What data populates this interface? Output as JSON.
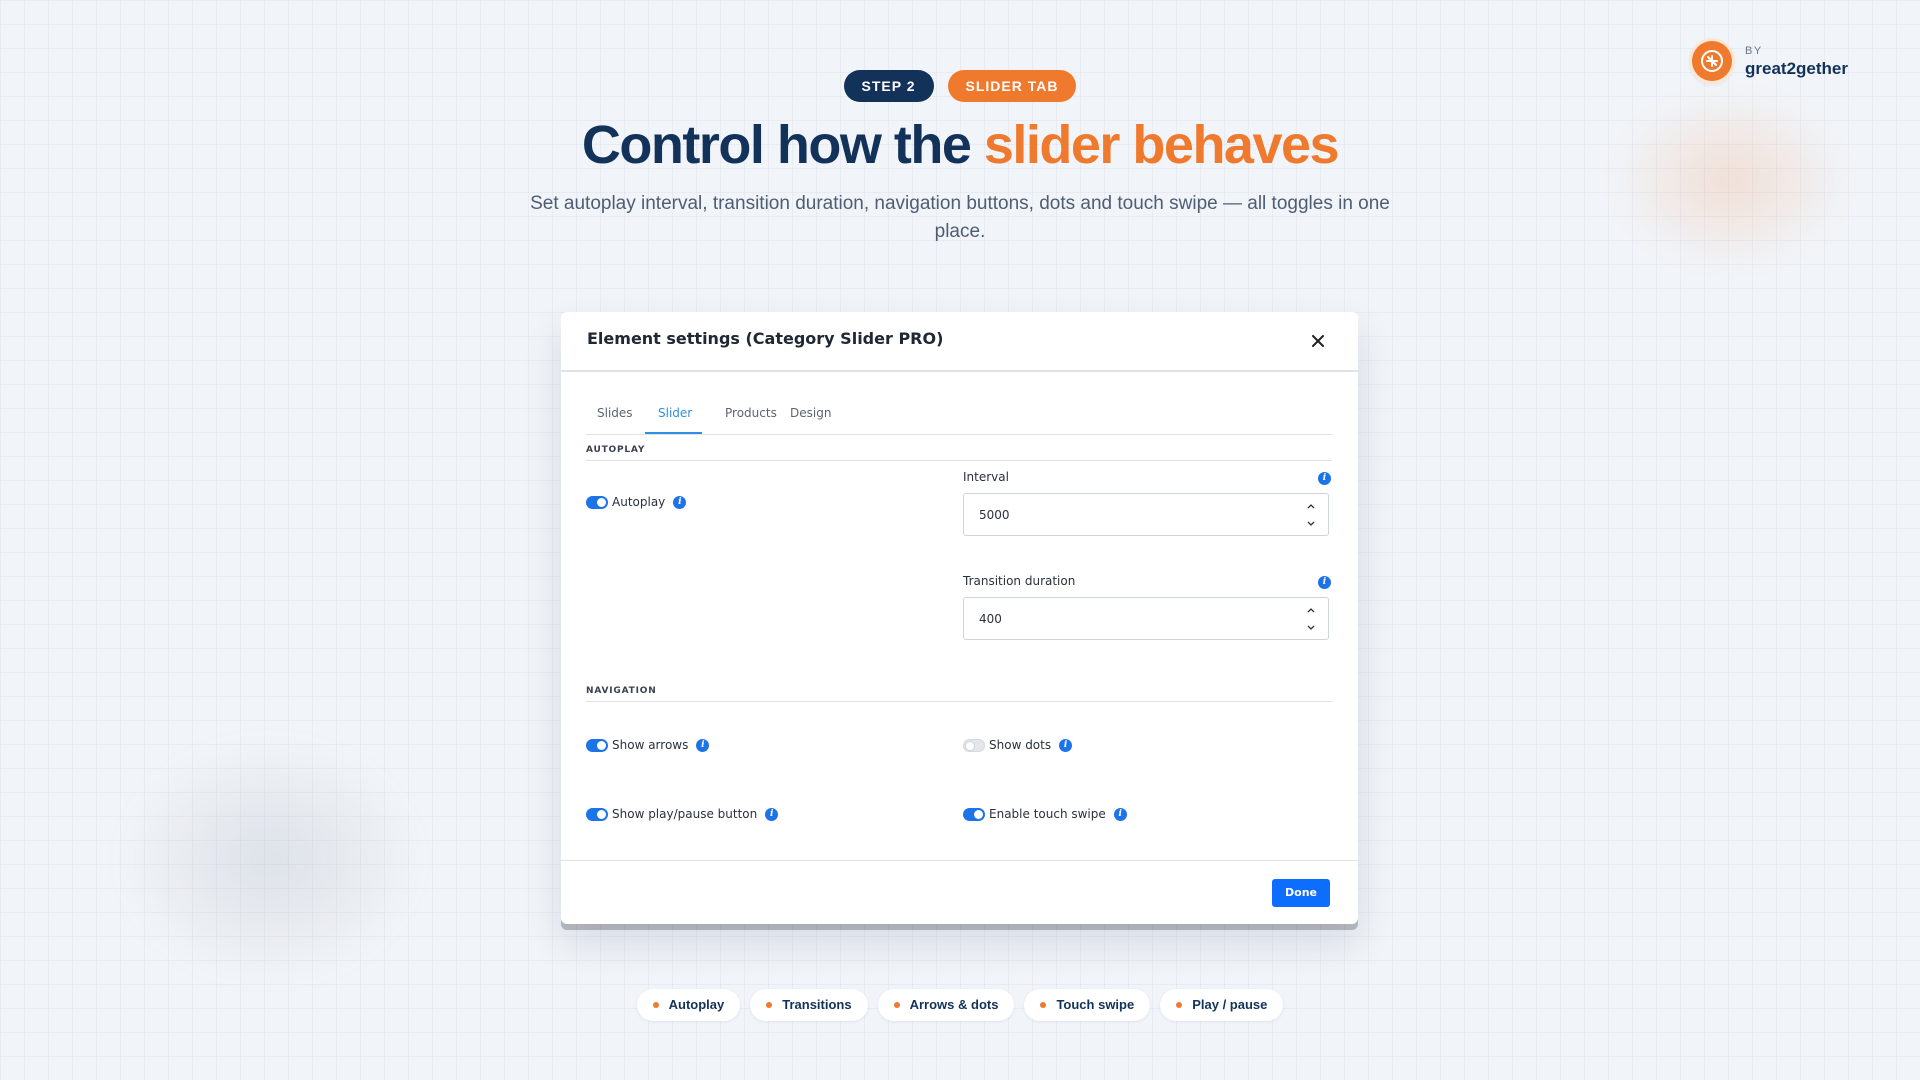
{
  "brand": {
    "by": "BY",
    "name": "great2gether"
  },
  "pills": {
    "step": "STEP 2",
    "tab": "SLIDER TAB"
  },
  "headline": {
    "part1": "Control how the ",
    "accent": "slider behaves"
  },
  "subtitle": "Set autoplay interval, transition duration, navigation buttons, dots and touch swipe — all toggles in one place.",
  "dialog": {
    "title": "Element settings (Category Slider PRO)",
    "tabs": [
      "Slides",
      "Slider",
      "Products",
      "Design"
    ],
    "active_tab": "Slider",
    "autoplay_section": "AUTOPLAY",
    "autoplay": {
      "label": "Autoplay",
      "on": true
    },
    "interval": {
      "label": "Interval",
      "value": "5000"
    },
    "transition": {
      "label": "Transition duration",
      "value": "400"
    },
    "navigation_section": "NAVIGATION",
    "show_arrows": {
      "label": "Show arrows",
      "on": true
    },
    "show_dots": {
      "label": "Show dots",
      "on": false
    },
    "show_play_pause": {
      "label": "Show play/pause button",
      "on": true
    },
    "touch_swipe": {
      "label": "Enable touch swipe",
      "on": true
    },
    "done_label": "Done"
  },
  "chips": [
    "Autoplay",
    "Transitions",
    "Arrows & dots",
    "Touch swipe",
    "Play / pause"
  ],
  "colors": {
    "navy": "#13325a",
    "orange": "#ef7a2e",
    "primary_blue": "#0d6efd",
    "tab_blue": "#2f8fe0"
  }
}
